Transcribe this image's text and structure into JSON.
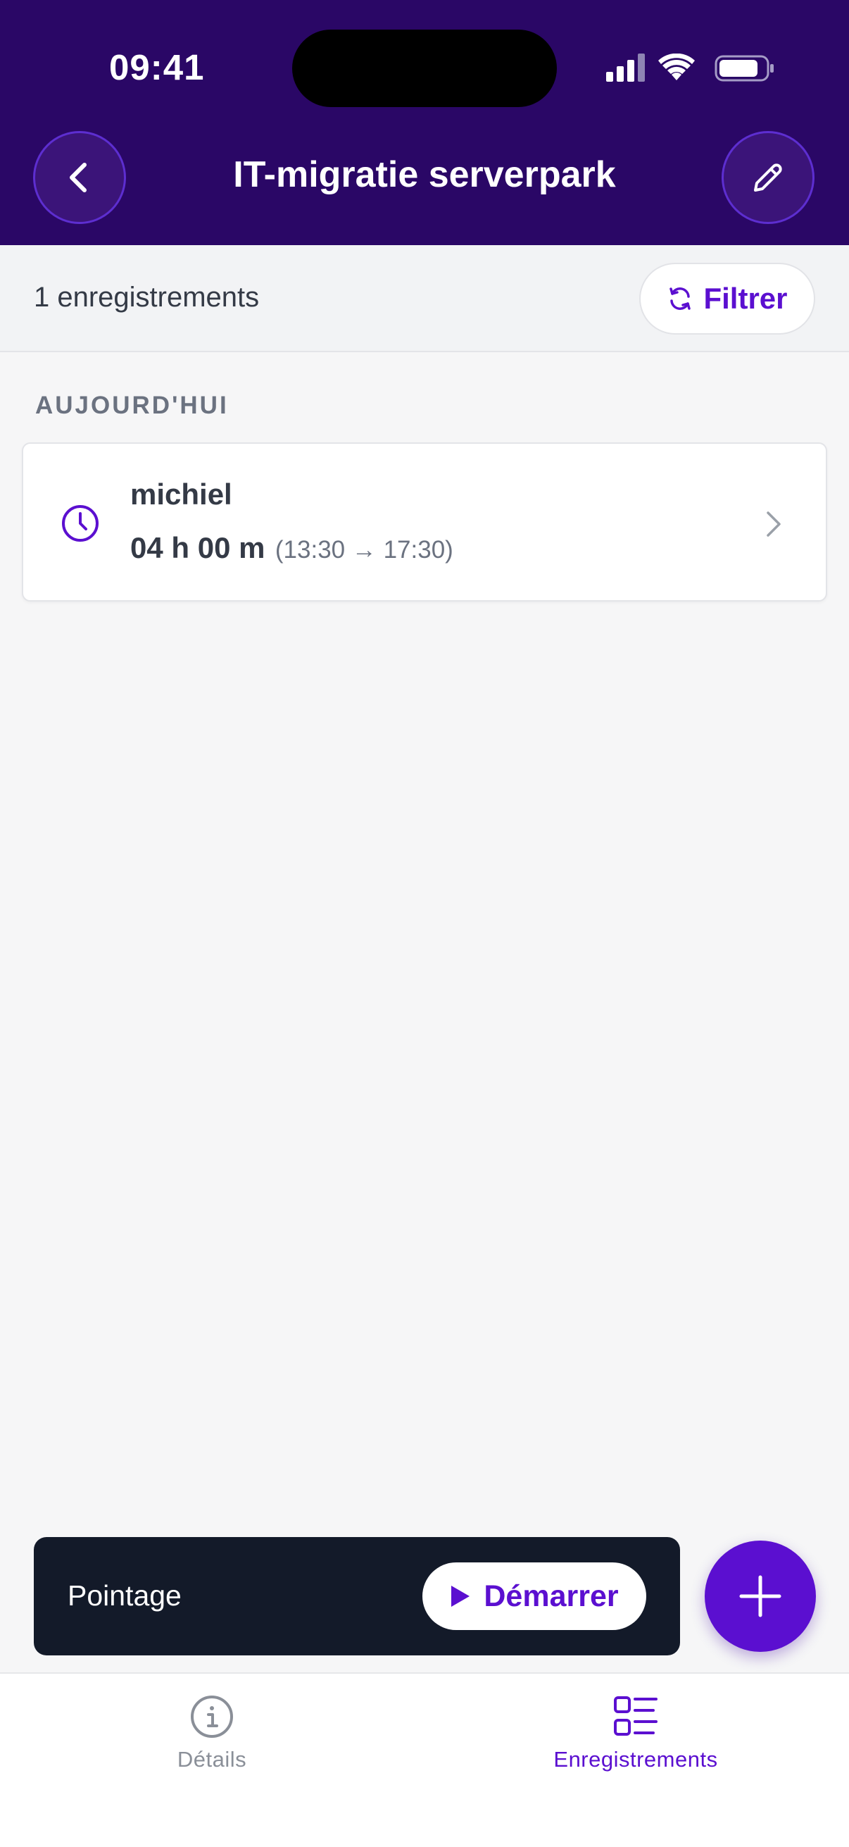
{
  "status_bar": {
    "time": "09:41"
  },
  "header": {
    "title": "IT-migratie serverpark",
    "back_icon": "chevron-left-icon",
    "edit_icon": "pencil-icon"
  },
  "toolbar": {
    "count_label": "1 enregistrements",
    "filter_label": "Filtrer",
    "filter_icon": "refresh-icon"
  },
  "section": {
    "title": "AUJOURD'HUI",
    "entries": [
      {
        "user": "michiel",
        "duration": "04 h 00 m",
        "range": "(13:30 → 17:30)"
      }
    ]
  },
  "timer": {
    "label": "Pointage",
    "start_label": "Démarrer"
  },
  "tabs": [
    {
      "label": "Détails",
      "icon": "info-icon",
      "active": false
    },
    {
      "label": "Enregistrements",
      "icon": "list-icon",
      "active": true
    }
  ],
  "colors": {
    "header_bg": "#2a0766",
    "accent": "#5b0fd0",
    "timer_bg": "#131a29",
    "page_bg": "#f6f6f7"
  }
}
